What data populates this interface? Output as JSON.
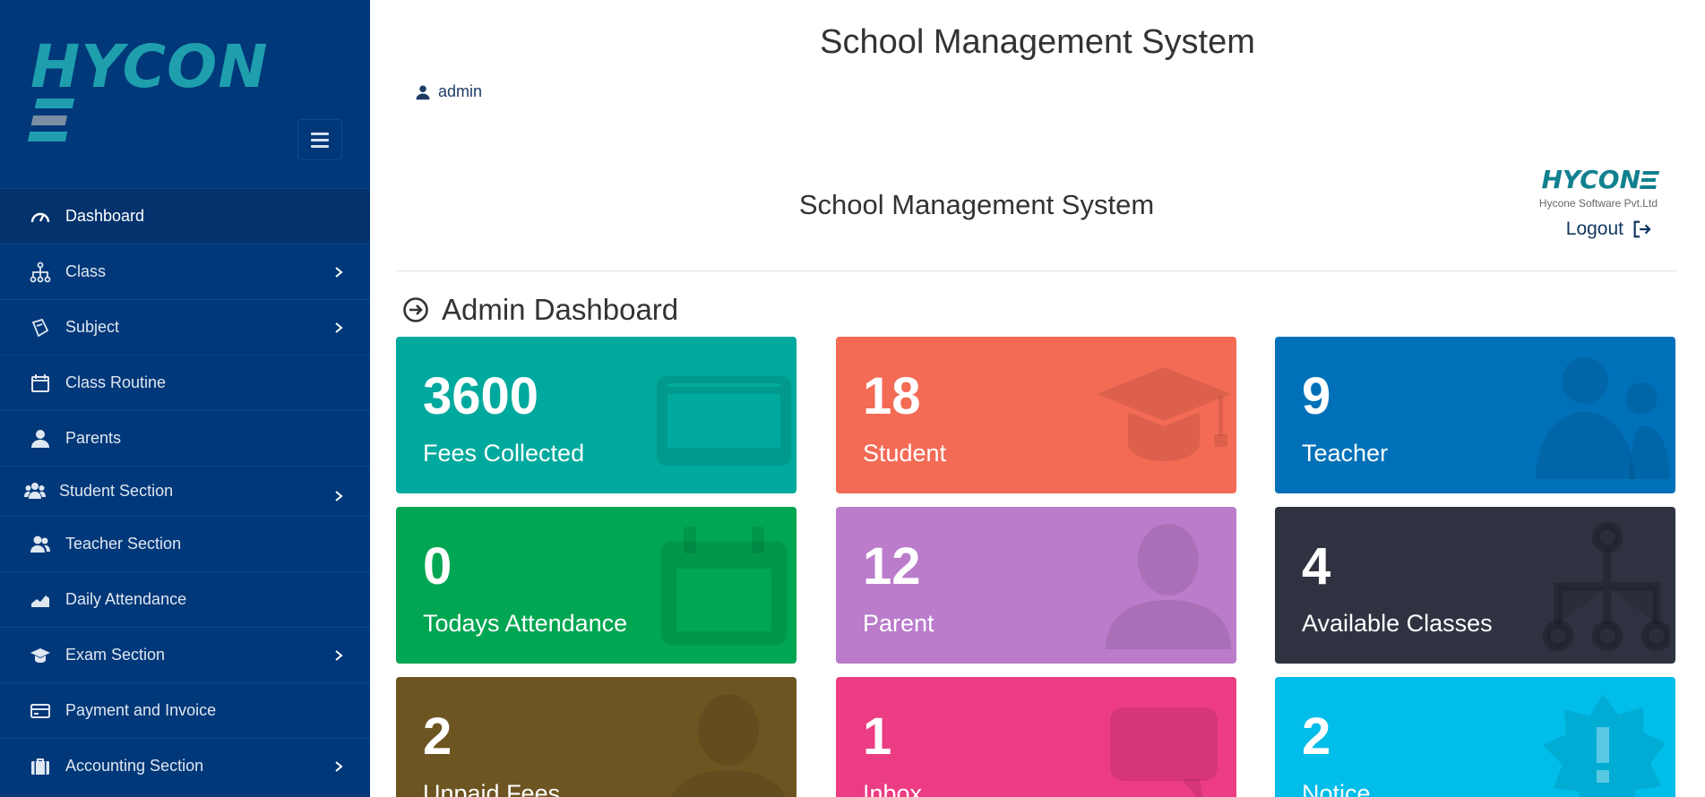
{
  "brand": {
    "logo_text": "HYCON",
    "mini_logo": "HYCON",
    "company": "Hycone Software Pvt.Ltd"
  },
  "header": {
    "title": "School Management System",
    "user": "admin",
    "subtitle": "School Management System",
    "logout": "Logout"
  },
  "sidebar": {
    "menu_icon": "hamburger-icon",
    "items": [
      {
        "label": "Dashboard",
        "icon": "speedometer-icon",
        "active": true,
        "has_submenu": false
      },
      {
        "label": "Class",
        "icon": "sitemap-icon",
        "active": false,
        "has_submenu": true
      },
      {
        "label": "Subject",
        "icon": "book-icon",
        "active": false,
        "has_submenu": true
      },
      {
        "label": "Class Routine",
        "icon": "calendar-icon",
        "active": false,
        "has_submenu": false
      },
      {
        "label": "Parents",
        "icon": "user-icon",
        "active": false,
        "has_submenu": false
      },
      {
        "label": "Student Section",
        "icon": "users-icon",
        "active": false,
        "has_submenu": true
      },
      {
        "label": "Teacher Section",
        "icon": "user-group-icon",
        "active": false,
        "has_submenu": false
      },
      {
        "label": "Daily Attendance",
        "icon": "area-chart-icon",
        "active": false,
        "has_submenu": false
      },
      {
        "label": "Exam Section",
        "icon": "graduation-cap-icon",
        "active": false,
        "has_submenu": true
      },
      {
        "label": "Payment and Invoice",
        "icon": "credit-card-icon",
        "active": false,
        "has_submenu": false
      },
      {
        "label": "Accounting Section",
        "icon": "briefcase-icon",
        "active": false,
        "has_submenu": true
      }
    ]
  },
  "dashboard": {
    "heading": "Admin Dashboard",
    "cards": [
      {
        "value": "3600",
        "label": "Fees Collected",
        "color": "#00a99d",
        "icon": "credit-card-icon"
      },
      {
        "value": "18",
        "label": "Student",
        "color": "#f36a55",
        "icon": "graduation-cap-icon"
      },
      {
        "value": "9",
        "label": "Teacher",
        "color": "#0071b9",
        "icon": "users-icon"
      },
      {
        "value": "0",
        "label": "Todays Attendance",
        "color": "#00a651",
        "icon": "calendar-icon"
      },
      {
        "value": "12",
        "label": "Parent",
        "color": "#ba7ccb",
        "icon": "user-icon"
      },
      {
        "value": "4",
        "label": "Available Classes",
        "color": "#2f3341",
        "icon": "sitemap-icon"
      },
      {
        "value": "2",
        "label": "Unpaid Fees",
        "color": "#6d5521",
        "icon": "user-icon"
      },
      {
        "value": "1",
        "label": "Inbox",
        "color": "#ec3c83",
        "icon": "comment-icon"
      },
      {
        "value": "2",
        "label": "Notice",
        "color": "#00bde9",
        "icon": "certificate-icon"
      }
    ]
  }
}
